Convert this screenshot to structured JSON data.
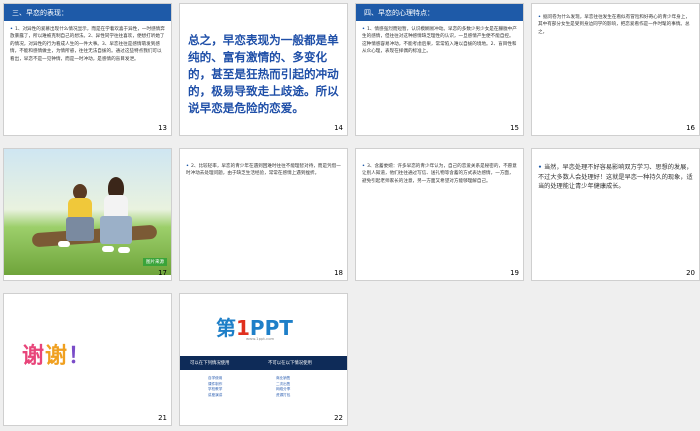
{
  "slides": [
    {
      "num": "13",
      "title": "三、早恋的表现：",
      "text": "1、对异性的爱慕出现什么情况显示，而是在学着欢喜于异性，一时感情奔放暴露了，所以难被克制自己的想法。2、异性同学往往喜欢，便想打听她了的情况，对异性的行为看成人生的一件大事。3、早恋往往是感情萌发到感情，不能和感情做主，为情所惑，往往无法自拔的。通过这些特点我们可以看出，早恋不是一见钟情，而是一时冲动，是感情的盲目发泄。"
    },
    {
      "num": "14",
      "text": "总之，早恋表现为一般都是单纯的、富有激情的、多变化的，甚至是狂热而引起的冲动的，极易导致走上歧途。所以说早恋是危险的恋爱。"
    },
    {
      "num": "15",
      "title": "四、早恋的心理特点：",
      "text": "1、情感强烈而短暂，认识模糊易冲动。早恋的多数少男少女是在朦胧中产生的感情，但往往对这种感情缺乏理性的认识，一旦感情产生便不能自控。这种情感容易冲动，不能考虑后果，常常陷入难以自拔的境地。2、盲目性和从众心理，表现在择偶的标准上。"
    },
    {
      "num": "16",
      "text": "据问卷为什么发现，早恋往往发生在看似有冒险和好奇心的青少年身上，其中有部分女生是受到身边同学的影响，把恋爱看作是一件时髦的事情。总之，"
    },
    {
      "num": "17",
      "badge": "图片来源"
    },
    {
      "num": "18",
      "text": "2、比较轻率，早恋的青少年在遇到困难时往往不能理智对待，而是凭借一时冲动去处理问题，由于缺乏生活经验，常常在感情上遇到挫折。"
    },
    {
      "num": "19",
      "text": "3、含蓄委婉：许多早恋的青少年认为，自己的恋爱关系是秘密的，不愿意让别人知道，他们往往通过写信、送礼物等含蓄的方式表达感情，一方面，避免引起老师家长的注意，另一方面又希望对方能够理解自己。"
    },
    {
      "num": "20",
      "text": "当然，早恋处理不好容易影响双方学习、思想的发展，不过大多数人会处理好！这就是早恋一种持久的现象，适当的处理能让青少年健康成长。"
    },
    {
      "num": "21",
      "thanks": "谢谢！"
    },
    {
      "num": "22",
      "logo_a": "第",
      "logo_b": "1",
      "logo_c": "PPT",
      "site": "www.1ppt.com",
      "band_left": "可以在下列情况使用",
      "band_right": "不可以在以下情况使用",
      "list_a": [
        "自学使用",
        "课件制作",
        "学校教学",
        "讲座演讲"
      ],
      "list_b": [
        "商业销售",
        "二次出售",
        "网络分享",
        "资源打包"
      ]
    }
  ],
  "colors": {
    "header_blue": "#1e5aa8",
    "body_text": "#333333",
    "big_text": "#1f4fa8",
    "page_bg": "#efefef"
  }
}
